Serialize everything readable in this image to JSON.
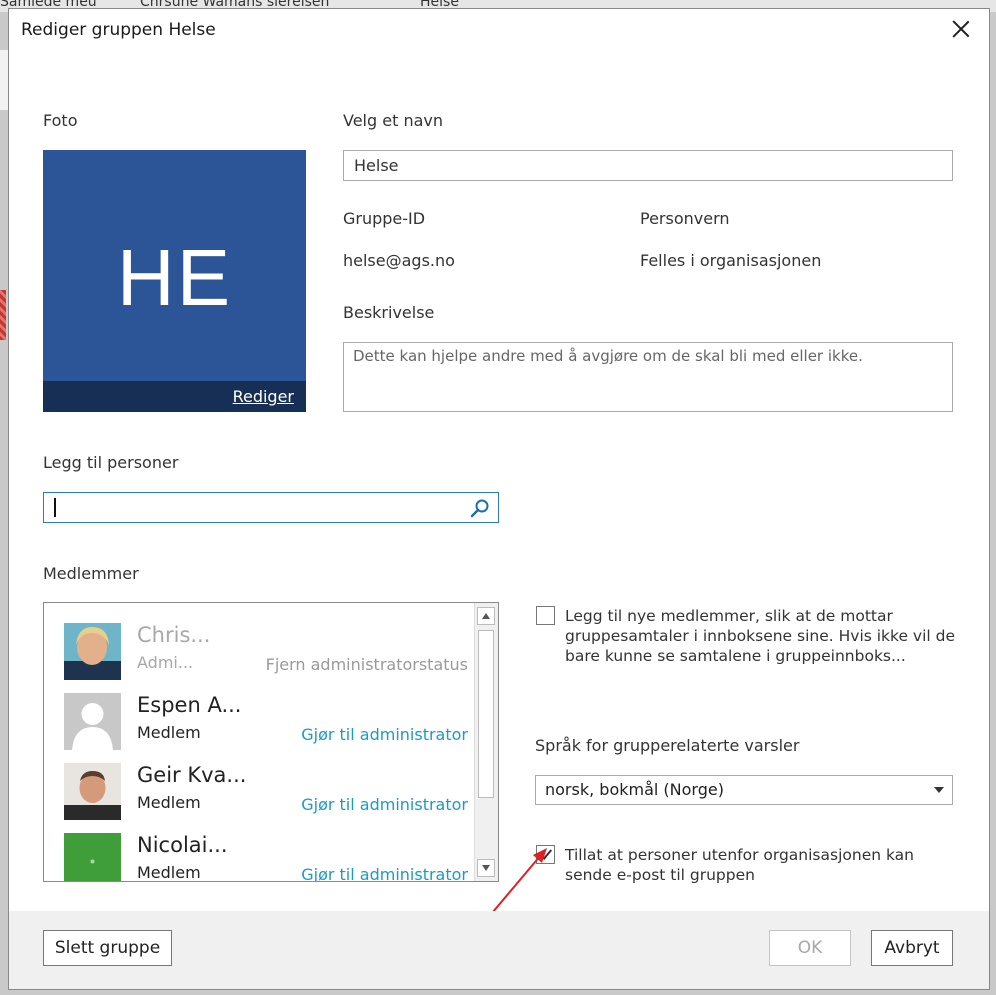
{
  "background": {
    "tabs": [
      "Samlede meu",
      "Chrsune Wamans siereisen",
      "Helse"
    ]
  },
  "dialog": {
    "title": "Rediger gruppen Helse"
  },
  "photo": {
    "label": "Foto",
    "initials": "HE",
    "edit_label": "Rediger",
    "bg_color": "#2b5597"
  },
  "name": {
    "label": "Velg et navn",
    "value": "Helse"
  },
  "group_id": {
    "label": "Gruppe-ID",
    "value": "helse@ags.no"
  },
  "privacy": {
    "label": "Personvern",
    "value": "Felles i organisasjonen"
  },
  "description": {
    "label": "Beskrivelse",
    "placeholder": "Dette kan hjelpe andre med å avgjøre om de skal bli med eller ikke."
  },
  "add_people": {
    "label": "Legg til personer",
    "value": ""
  },
  "members": {
    "label": "Medlemmer",
    "items": [
      {
        "name": "Chris...",
        "role": "Admi...",
        "action": "Fjern administratorstatus"
      },
      {
        "name": "Espen A...",
        "role": "Medlem",
        "action": "Gjør til administrator"
      },
      {
        "name": "Geir Kva...",
        "role": "Medlem",
        "action": "Gjør til administrator"
      },
      {
        "name": "Nicolai...",
        "role": "Medlem",
        "action": "Gjør til administrator"
      }
    ]
  },
  "subscribe_new_members": {
    "checked": false,
    "text": "Legg til nye medlemmer, slik at de mottar gruppesamtaler i innboksene sine. Hvis ikke vil de bare kunne se samtalene i gruppeinnboks..."
  },
  "language": {
    "label": "Språk for grupperelaterte varsler",
    "value": "norsk, bokmål (Norge)"
  },
  "allow_external": {
    "checked": true,
    "text": "Tillat at personer utenfor organisasjonen kan sende e-post til gruppen"
  },
  "buttons": {
    "delete": "Slett gruppe",
    "ok": "OK",
    "cancel": "Avbryt"
  },
  "colors": {
    "accent": "#1a9bc2",
    "annotation_arrow": "#e02020"
  }
}
